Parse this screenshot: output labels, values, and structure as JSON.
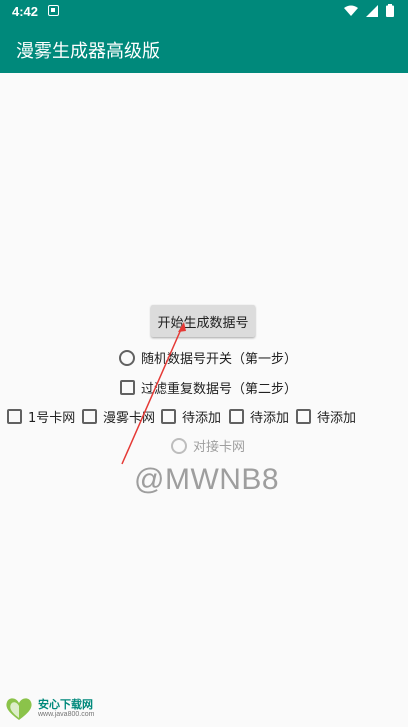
{
  "status_bar": {
    "time": "4:42"
  },
  "app_bar": {
    "title": "漫雾生成器高级版"
  },
  "main_button": {
    "label": "开始生成数据号"
  },
  "options": {
    "random_switch": "随机数据号开关（第一步）",
    "filter_duplicates": "过滤重复数据号（第二步）"
  },
  "card_checkboxes": [
    "1号卡网",
    "漫雾卡网",
    "待添加",
    "待添加",
    "待添加"
  ],
  "connect_card": {
    "label": "对接卡网"
  },
  "watermark": "@MWNB8",
  "bottom_logo": {
    "name": "安心下载网",
    "url": "www.java800.com"
  },
  "colors": {
    "primary": "#00897b",
    "arrow": "#e53935",
    "background": "#fafafa"
  }
}
